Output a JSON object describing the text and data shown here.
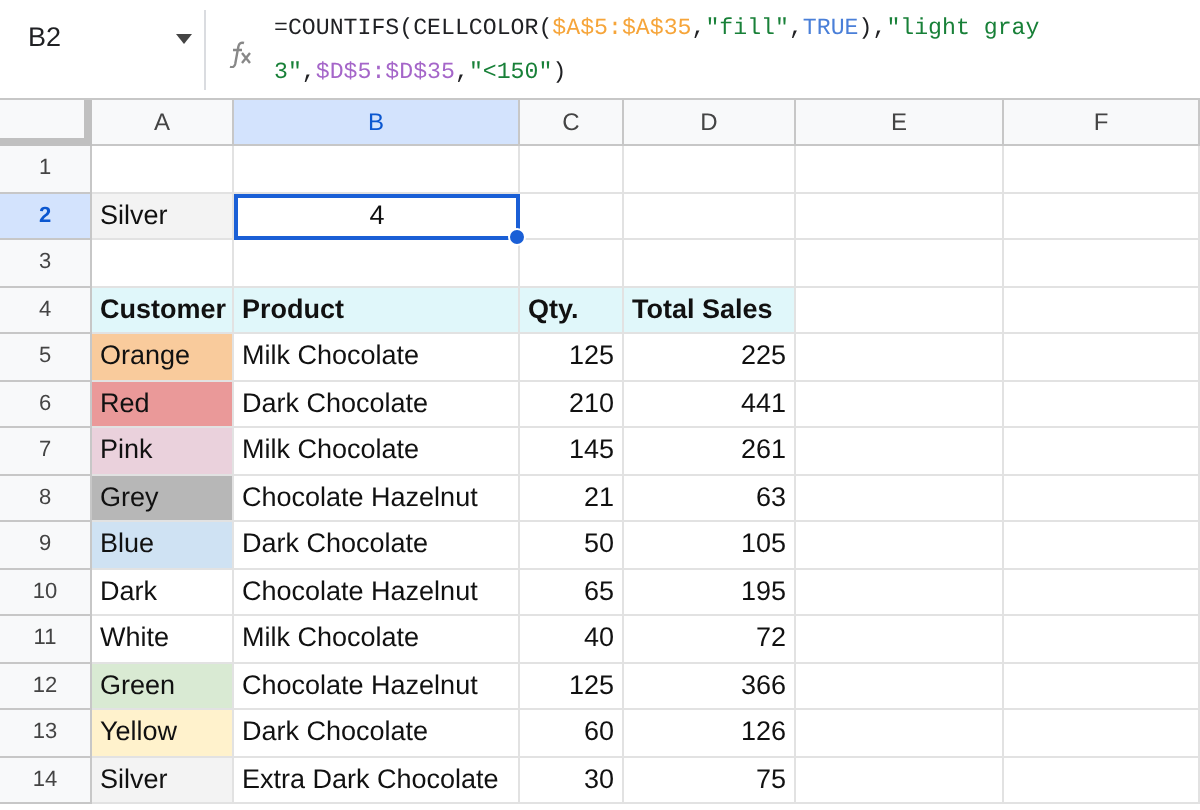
{
  "formula_bar": {
    "name_box": "B2",
    "formula": [
      {
        "text": "=COUNTIFS(CELLCOLOR(",
        "color": "#202124"
      },
      {
        "text": "$A$5:$A$35",
        "color": "#f6a53a"
      },
      {
        "text": ",",
        "color": "#202124"
      },
      {
        "text": "\"fill\"",
        "color": "#188038"
      },
      {
        "text": ",",
        "color": "#202124"
      },
      {
        "text": "TRUE",
        "color": "#4a7fd8"
      },
      {
        "text": "),",
        "color": "#202124"
      },
      {
        "text": "\"light gray 3\"",
        "color": "#188038"
      },
      {
        "text": ",",
        "color": "#202124"
      },
      {
        "text": "$D$5:$D$35",
        "color": "#a566c9"
      },
      {
        "text": ",",
        "color": "#202124"
      },
      {
        "text": "\"<150\"",
        "color": "#188038"
      },
      {
        "text": ")",
        "color": "#202124"
      }
    ]
  },
  "columns": [
    {
      "label": "A",
      "selected": false
    },
    {
      "label": "B",
      "selected": true
    },
    {
      "label": "C",
      "selected": false
    },
    {
      "label": "D",
      "selected": false
    },
    {
      "label": "E",
      "selected": false
    },
    {
      "label": "F",
      "selected": false
    }
  ],
  "rows": [
    {
      "number": "1",
      "selected": false
    },
    {
      "number": "2",
      "selected": true,
      "cells": [
        {
          "text": "Silver",
          "kind": "text",
          "color": "#f3f3f3"
        },
        {
          "text": "4",
          "kind": "result",
          "selected": true
        }
      ]
    },
    {
      "number": "3",
      "selected": false
    },
    {
      "number": "4",
      "selected": false,
      "cells": [
        {
          "text": "Customer",
          "kind": "header"
        },
        {
          "text": "Product",
          "kind": "header"
        },
        {
          "text": "Qty.",
          "kind": "header"
        },
        {
          "text": "Total Sales",
          "kind": "header"
        }
      ]
    },
    {
      "number": "5",
      "selected": false,
      "cells": [
        {
          "text": "Orange",
          "kind": "text",
          "color": "#f9cb9c"
        },
        {
          "text": "Milk Chocolate",
          "kind": "text"
        },
        {
          "text": "125",
          "kind": "number"
        },
        {
          "text": "225",
          "kind": "number"
        }
      ]
    },
    {
      "number": "6",
      "selected": false,
      "cells": [
        {
          "text": "Red",
          "kind": "text",
          "color": "#ea9999"
        },
        {
          "text": "Dark Chocolate",
          "kind": "text"
        },
        {
          "text": "210",
          "kind": "number"
        },
        {
          "text": "441",
          "kind": "number"
        }
      ]
    },
    {
      "number": "7",
      "selected": false,
      "cells": [
        {
          "text": "Pink",
          "kind": "text",
          "color": "#ead1dc"
        },
        {
          "text": "Milk Chocolate",
          "kind": "text"
        },
        {
          "text": "145",
          "kind": "number"
        },
        {
          "text": "261",
          "kind": "number"
        }
      ]
    },
    {
      "number": "8",
      "selected": false,
      "cells": [
        {
          "text": "Grey",
          "kind": "text",
          "color": "#b7b7b7"
        },
        {
          "text": "Chocolate Hazelnut",
          "kind": "text"
        },
        {
          "text": "21",
          "kind": "number"
        },
        {
          "text": "63",
          "kind": "number"
        }
      ]
    },
    {
      "number": "9",
      "selected": false,
      "cells": [
        {
          "text": "Blue",
          "kind": "text",
          "color": "#cfe2f3"
        },
        {
          "text": "Dark Chocolate",
          "kind": "text"
        },
        {
          "text": "50",
          "kind": "number"
        },
        {
          "text": "105",
          "kind": "number"
        }
      ]
    },
    {
      "number": "10",
      "selected": false,
      "cells": [
        {
          "text": "Dark",
          "kind": "text"
        },
        {
          "text": "Chocolate Hazelnut",
          "kind": "text"
        },
        {
          "text": "65",
          "kind": "number"
        },
        {
          "text": "195",
          "kind": "number"
        }
      ]
    },
    {
      "number": "11",
      "selected": false,
      "cells": [
        {
          "text": "White",
          "kind": "text"
        },
        {
          "text": "Milk Chocolate",
          "kind": "text"
        },
        {
          "text": "40",
          "kind": "number"
        },
        {
          "text": "72",
          "kind": "number"
        }
      ]
    },
    {
      "number": "12",
      "selected": false,
      "cells": [
        {
          "text": "Green",
          "kind": "text",
          "color": "#d9ead3"
        },
        {
          "text": "Chocolate Hazelnut",
          "kind": "text"
        },
        {
          "text": "125",
          "kind": "number"
        },
        {
          "text": "366",
          "kind": "number"
        }
      ]
    },
    {
      "number": "13",
      "selected": false,
      "cells": [
        {
          "text": "Yellow",
          "kind": "text",
          "color": "#fff2cc"
        },
        {
          "text": "Dark Chocolate",
          "kind": "text"
        },
        {
          "text": "60",
          "kind": "number"
        },
        {
          "text": "126",
          "kind": "number"
        }
      ]
    },
    {
      "number": "14",
      "selected": false,
      "cells": [
        {
          "text": "Silver",
          "kind": "text",
          "color": "#f3f3f3"
        },
        {
          "text": "Extra Dark Chocolate",
          "kind": "text"
        },
        {
          "text": "30",
          "kind": "number"
        },
        {
          "text": "75",
          "kind": "number"
        }
      ]
    }
  ]
}
